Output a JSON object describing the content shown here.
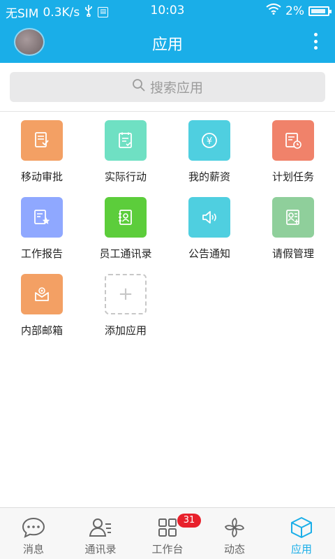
{
  "status_bar": {
    "carrier": "无SIM",
    "speed": "0.3K/s",
    "time": "10:03",
    "battery": "2%"
  },
  "header": {
    "title": "应用"
  },
  "search": {
    "placeholder": "搜索应用"
  },
  "apps": [
    {
      "label": "移动审批",
      "color": "#f3a064",
      "icon": "approval-icon"
    },
    {
      "label": "实际行动",
      "color": "#6fe0c3",
      "icon": "checklist-icon"
    },
    {
      "label": "我的薪资",
      "color": "#4fcfe0",
      "icon": "salary-icon"
    },
    {
      "label": "计划任务",
      "color": "#f0826a",
      "icon": "task-plan-icon"
    },
    {
      "label": "工作报告",
      "color": "#8fa8ff",
      "icon": "report-icon"
    },
    {
      "label": "员工通讯录",
      "color": "#5ccd3b",
      "icon": "contacts-book-icon"
    },
    {
      "label": "公告通知",
      "color": "#4fcfe0",
      "icon": "announcement-icon"
    },
    {
      "label": "请假管理",
      "color": "#8fcf9b",
      "icon": "leave-icon"
    },
    {
      "label": "内部邮箱",
      "color": "#f3a064",
      "icon": "mailbox-icon"
    }
  ],
  "add_app": {
    "label": "添加应用"
  },
  "tabs": [
    {
      "label": "消息",
      "icon": "chat-bubble-icon"
    },
    {
      "label": "通讯录",
      "icon": "contacts-icon"
    },
    {
      "label": "工作台",
      "icon": "grid-icon",
      "badge": "31"
    },
    {
      "label": "动态",
      "icon": "pinwheel-icon"
    },
    {
      "label": "应用",
      "icon": "cube-icon"
    }
  ],
  "colors": {
    "primary": "#1aaee8",
    "badge": "#e8212c"
  }
}
